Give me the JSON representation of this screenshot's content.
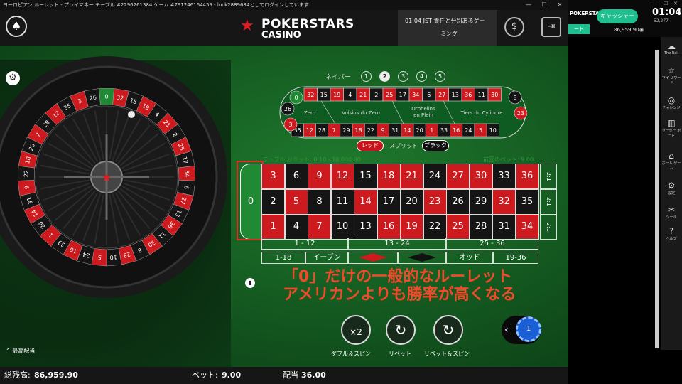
{
  "window": {
    "title": "ヨーロピアン ルーレット - プレイマネー テーブル #2296261384 ゲーム #791246164459 - luck2889684としてログインしています",
    "min": "—",
    "max": "☐",
    "close": "✕"
  },
  "header": {
    "logo_line1": "POKERSTARS",
    "logo_line2": "CASINO",
    "notice_line1": "01:04 JST 責任と分別あるゲー",
    "notice_line2": "ミング",
    "menu_icon": "spade-icon",
    "cashier_icon": "cashier-icon",
    "exit_icon": "exit-icon"
  },
  "table": {
    "table_limit": "テーブル リミット: 0.10 - 18,000.00",
    "last_bet": "前回のベット: 9.00",
    "neighbors_label": "ネイバー",
    "neighbors": [
      "1",
      "2",
      "3",
      "4",
      "5"
    ],
    "neighbors_selected": "2",
    "racetrack": {
      "top": [
        "32",
        "15",
        "19",
        "4",
        "21",
        "2",
        "25",
        "17",
        "34",
        "6",
        "27",
        "13",
        "36",
        "11",
        "30"
      ],
      "bottom": [
        "35",
        "12",
        "28",
        "7",
        "29",
        "18",
        "22",
        "9",
        "31",
        "14",
        "20",
        "1",
        "33",
        "16",
        "24",
        "5",
        "10"
      ],
      "left": [
        "0",
        "26",
        "3"
      ],
      "right": [
        "8",
        "23"
      ],
      "sections": [
        "Zero",
        "Voisins du Zero",
        "Orphelins en Plein",
        "Tiers du Cylindre"
      ]
    },
    "bet_red": "レッド",
    "bet_split": "スプリット",
    "bet_black": "ブラック",
    "zero": "0",
    "grid": [
      [
        {
          "n": "3",
          "c": "red"
        },
        {
          "n": "6",
          "c": "black"
        },
        {
          "n": "9",
          "c": "red"
        },
        {
          "n": "12",
          "c": "red"
        },
        {
          "n": "15",
          "c": "black"
        },
        {
          "n": "18",
          "c": "red"
        },
        {
          "n": "21",
          "c": "red"
        },
        {
          "n": "24",
          "c": "black"
        },
        {
          "n": "27",
          "c": "red"
        },
        {
          "n": "30",
          "c": "red"
        },
        {
          "n": "33",
          "c": "black"
        },
        {
          "n": "36",
          "c": "red"
        }
      ],
      [
        {
          "n": "2",
          "c": "black"
        },
        {
          "n": "5",
          "c": "red"
        },
        {
          "n": "8",
          "c": "black"
        },
        {
          "n": "11",
          "c": "black"
        },
        {
          "n": "14",
          "c": "red"
        },
        {
          "n": "17",
          "c": "black"
        },
        {
          "n": "20",
          "c": "black"
        },
        {
          "n": "23",
          "c": "red"
        },
        {
          "n": "26",
          "c": "black"
        },
        {
          "n": "29",
          "c": "black"
        },
        {
          "n": "32",
          "c": "red"
        },
        {
          "n": "35",
          "c": "black"
        }
      ],
      [
        {
          "n": "1",
          "c": "red"
        },
        {
          "n": "4",
          "c": "black"
        },
        {
          "n": "7",
          "c": "red"
        },
        {
          "n": "10",
          "c": "black"
        },
        {
          "n": "13",
          "c": "black"
        },
        {
          "n": "16",
          "c": "red"
        },
        {
          "n": "19",
          "c": "red"
        },
        {
          "n": "22",
          "c": "black"
        },
        {
          "n": "25",
          "c": "red"
        },
        {
          "n": "28",
          "c": "black"
        },
        {
          "n": "31",
          "c": "black"
        },
        {
          "n": "34",
          "c": "red"
        }
      ]
    ],
    "column_bet": "2:1",
    "dozens": [
      "1 - 12",
      "13 - 24",
      "25 - 36"
    ],
    "outside": {
      "low": "1-18",
      "even": "イーブン",
      "odd": "オッド",
      "high": "19-36"
    },
    "colors": {
      "red": "#cc1a1e",
      "black": "#151515",
      "felt": "#1f7a2d"
    }
  },
  "wheel": {
    "numbers": [
      "0",
      "32",
      "15",
      "19",
      "4",
      "21",
      "2",
      "25",
      "17",
      "34",
      "6",
      "27",
      "13",
      "36",
      "11",
      "30",
      "8",
      "23",
      "10",
      "5",
      "24",
      "16",
      "33",
      "1",
      "20",
      "14",
      "31",
      "9",
      "22",
      "18",
      "29",
      "7",
      "28",
      "12",
      "35",
      "3",
      "26"
    ]
  },
  "caption": {
    "line1": "「0」だけの一般的なルーレット",
    "line2": "アメリカンよりも勝率が高くなる"
  },
  "controls": {
    "double_spin": "ダブル＆スピン",
    "rebet": "リベット",
    "rebet_spin": "リベット＆スピン",
    "chip_value": "1",
    "max_bet": "最高配当"
  },
  "footer": {
    "balance_label": "総残高:",
    "balance": "86,959.90",
    "bet_label": "ベット:",
    "bet": "9.00",
    "payout_label": "配当",
    "payout": "36.00"
  },
  "side_panel": {
    "brand": "POKERSTARS",
    "cashier": "キャッシャー",
    "time": "01:04",
    "balance": "86,959.90",
    "players": "52,277",
    "tab_label": "ート",
    "items": [
      {
        "label": "The Rail",
        "icon": "rail-icon"
      },
      {
        "label": "マイ リワード",
        "icon": "star-icon"
      },
      {
        "label": "チャレンジ",
        "icon": "target-icon"
      },
      {
        "label": "リーダー ボード",
        "icon": "leaderboard-icon"
      },
      {
        "label": "ホーム ゲーム",
        "icon": "home-icon"
      },
      {
        "label": "設定",
        "icon": "gear-icon"
      },
      {
        "label": "ツール",
        "icon": "tool-icon"
      },
      {
        "label": "ヘルプ",
        "icon": "help-icon"
      }
    ]
  }
}
